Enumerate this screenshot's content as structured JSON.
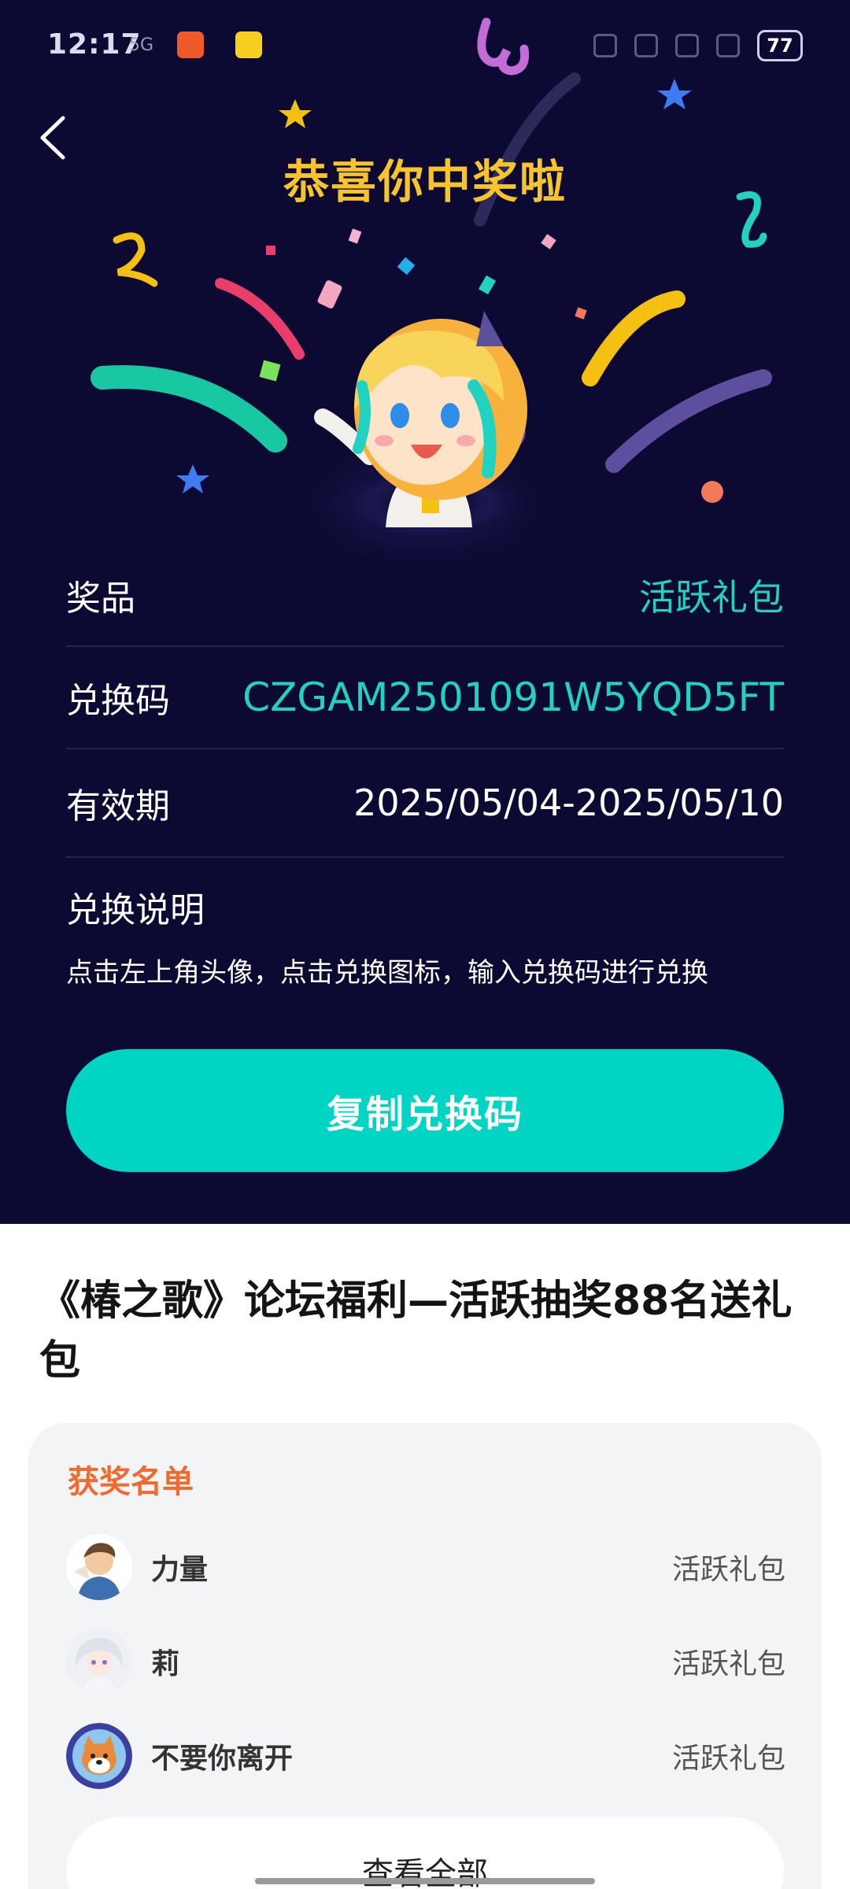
{
  "status_bar": {
    "time": "12:17",
    "network_text": "5G",
    "battery": "77"
  },
  "header": {
    "title": "恭喜你中奖啦"
  },
  "prize_info": {
    "prize_label": "奖品",
    "prize_value": "活跃礼包",
    "code_label": "兑换码",
    "code_value": "CZGAM2501091W5YQD5FT",
    "validity_label": "有效期",
    "validity_value": "2025/05/04-2025/05/10"
  },
  "instructions": {
    "title": "兑换说明",
    "text": "点击左上角头像，点击兑换图标，输入兑换码进行兑换"
  },
  "copy_button": {
    "label": "复制兑换码"
  },
  "post": {
    "title": "《椿之歌》论坛福利—活跃抽奖88名送礼包"
  },
  "winners": {
    "heading": "获奖名单",
    "list": [
      {
        "name": "力量",
        "prize": "活跃礼包"
      },
      {
        "name": "莉",
        "prize": "活跃礼包"
      },
      {
        "name": "不要你离开",
        "prize": "活跃礼包"
      }
    ],
    "view_all_label": "查看全部"
  },
  "colors": {
    "dark_bg": "#0c0a33",
    "title_gold": "#f7c52b",
    "teal": "#00d4c3",
    "orange_heading": "#f06a2e"
  }
}
